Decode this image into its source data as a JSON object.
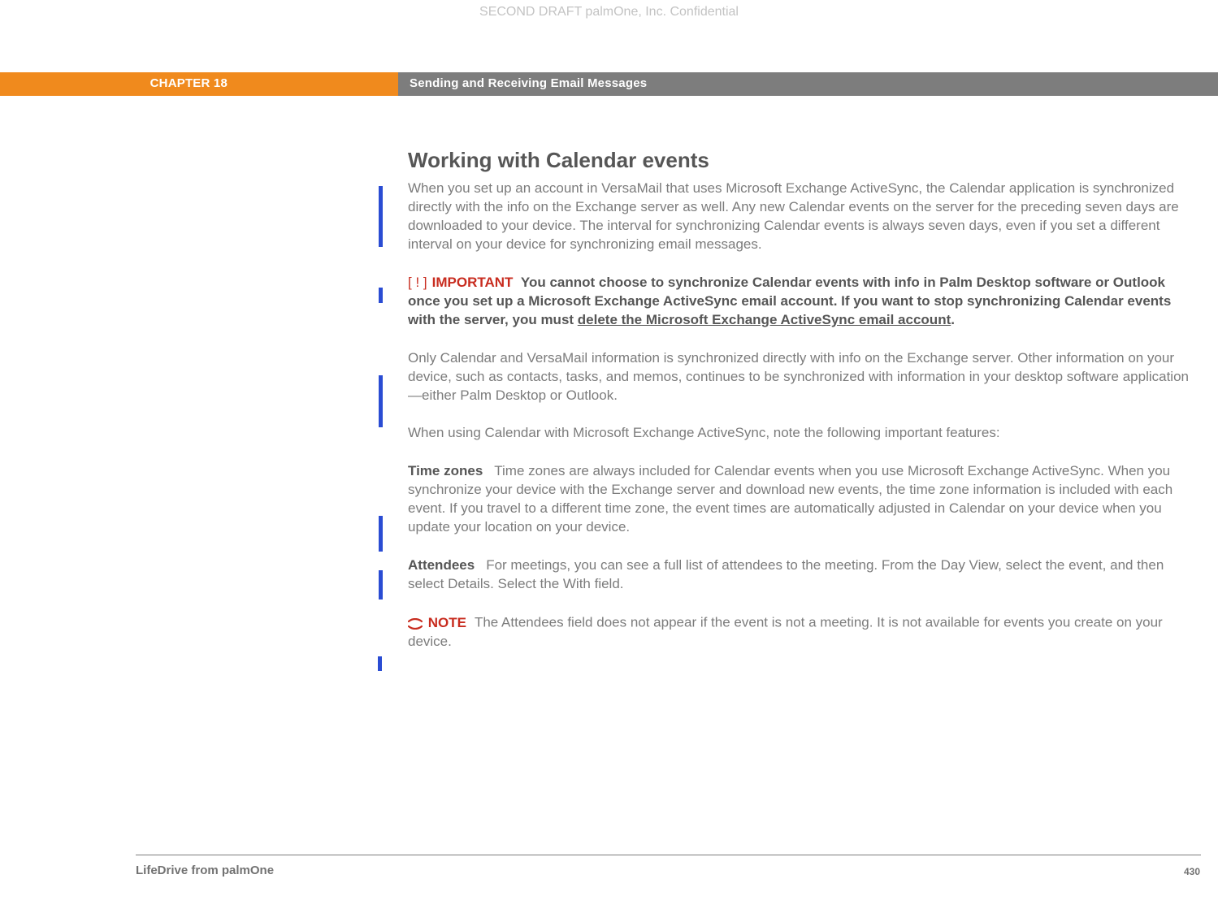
{
  "watermark": "SECOND DRAFT palmOne, Inc.  Confidential",
  "chapter_label": "CHAPTER 18",
  "section_title": "Sending and Receiving Email Messages",
  "heading": "Working with Calendar events",
  "intro": "When you set up an account in VersaMail that uses Microsoft Exchange ActiveSync, the Calendar application is synchronized directly with the info on the Exchange server as well. Any new Calendar events on the server for the preceding seven days are downloaded to your device. The interval for synchronizing Calendar events is always seven days, even if you set a different interval on your device for synchronizing email messages.",
  "important_badge": "[ ! ]",
  "important_label": "IMPORTANT",
  "important_prefix": "You cannot choose to synchronize Calendar events with info in Palm Desktop software or Outlook once you set up a Microsoft Exchange ActiveSync email account. If you want to stop synchronizing Calendar events with the server, you must ",
  "important_link": "delete the Microsoft Exchange ActiveSync email account",
  "important_suffix": ".",
  "sync_scope": "Only Calendar and VersaMail information is synchronized directly with info on the Exchange server. Other information on your device, such as contacts, tasks, and memos, continues to be synchronized with information in your desktop software application—either Palm Desktop or Outlook.",
  "features_lead": "When using Calendar with Microsoft Exchange ActiveSync, note the following important features:",
  "tz_label": "Time zones",
  "tz_body": "Time zones are always included for Calendar events when you use Microsoft Exchange ActiveSync. When you synchronize your device with the Exchange server and download new events, the time zone information is included with each event. If you travel to a different time zone, the event times are automatically adjusted in Calendar on your device when you update your location on your device.",
  "att_label": "Attendees",
  "att_body": "For meetings, you can see a full list of attendees to the meeting. From the Day View, select the event, and then select Details. Select the With field.",
  "note_label": "NOTE",
  "note_body": "The Attendees field does not appear if the event is not a meeting. It is not available for events you create on your device.",
  "footer_left": "LifeDrive from palmOne",
  "footer_right": "430"
}
